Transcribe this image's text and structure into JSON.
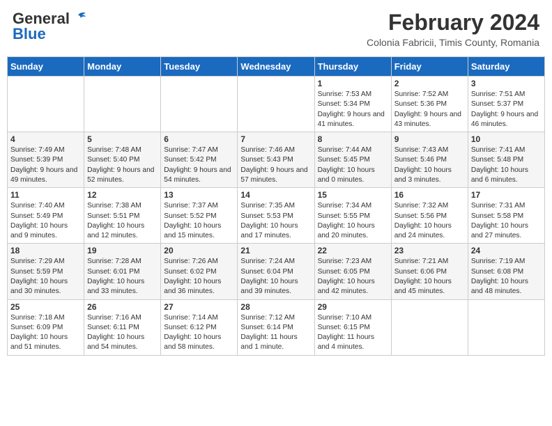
{
  "header": {
    "logo_general": "General",
    "logo_blue": "Blue",
    "month_title": "February 2024",
    "subtitle": "Colonia Fabricii, Timis County, Romania"
  },
  "days_of_week": [
    "Sunday",
    "Monday",
    "Tuesday",
    "Wednesday",
    "Thursday",
    "Friday",
    "Saturday"
  ],
  "weeks": [
    [
      {
        "day": "",
        "info": ""
      },
      {
        "day": "",
        "info": ""
      },
      {
        "day": "",
        "info": ""
      },
      {
        "day": "",
        "info": ""
      },
      {
        "day": "1",
        "info": "Sunrise: 7:53 AM\nSunset: 5:34 PM\nDaylight: 9 hours and 41 minutes."
      },
      {
        "day": "2",
        "info": "Sunrise: 7:52 AM\nSunset: 5:36 PM\nDaylight: 9 hours and 43 minutes."
      },
      {
        "day": "3",
        "info": "Sunrise: 7:51 AM\nSunset: 5:37 PM\nDaylight: 9 hours and 46 minutes."
      }
    ],
    [
      {
        "day": "4",
        "info": "Sunrise: 7:49 AM\nSunset: 5:39 PM\nDaylight: 9 hours and 49 minutes."
      },
      {
        "day": "5",
        "info": "Sunrise: 7:48 AM\nSunset: 5:40 PM\nDaylight: 9 hours and 52 minutes."
      },
      {
        "day": "6",
        "info": "Sunrise: 7:47 AM\nSunset: 5:42 PM\nDaylight: 9 hours and 54 minutes."
      },
      {
        "day": "7",
        "info": "Sunrise: 7:46 AM\nSunset: 5:43 PM\nDaylight: 9 hours and 57 minutes."
      },
      {
        "day": "8",
        "info": "Sunrise: 7:44 AM\nSunset: 5:45 PM\nDaylight: 10 hours and 0 minutes."
      },
      {
        "day": "9",
        "info": "Sunrise: 7:43 AM\nSunset: 5:46 PM\nDaylight: 10 hours and 3 minutes."
      },
      {
        "day": "10",
        "info": "Sunrise: 7:41 AM\nSunset: 5:48 PM\nDaylight: 10 hours and 6 minutes."
      }
    ],
    [
      {
        "day": "11",
        "info": "Sunrise: 7:40 AM\nSunset: 5:49 PM\nDaylight: 10 hours and 9 minutes."
      },
      {
        "day": "12",
        "info": "Sunrise: 7:38 AM\nSunset: 5:51 PM\nDaylight: 10 hours and 12 minutes."
      },
      {
        "day": "13",
        "info": "Sunrise: 7:37 AM\nSunset: 5:52 PM\nDaylight: 10 hours and 15 minutes."
      },
      {
        "day": "14",
        "info": "Sunrise: 7:35 AM\nSunset: 5:53 PM\nDaylight: 10 hours and 17 minutes."
      },
      {
        "day": "15",
        "info": "Sunrise: 7:34 AM\nSunset: 5:55 PM\nDaylight: 10 hours and 20 minutes."
      },
      {
        "day": "16",
        "info": "Sunrise: 7:32 AM\nSunset: 5:56 PM\nDaylight: 10 hours and 24 minutes."
      },
      {
        "day": "17",
        "info": "Sunrise: 7:31 AM\nSunset: 5:58 PM\nDaylight: 10 hours and 27 minutes."
      }
    ],
    [
      {
        "day": "18",
        "info": "Sunrise: 7:29 AM\nSunset: 5:59 PM\nDaylight: 10 hours and 30 minutes."
      },
      {
        "day": "19",
        "info": "Sunrise: 7:28 AM\nSunset: 6:01 PM\nDaylight: 10 hours and 33 minutes."
      },
      {
        "day": "20",
        "info": "Sunrise: 7:26 AM\nSunset: 6:02 PM\nDaylight: 10 hours and 36 minutes."
      },
      {
        "day": "21",
        "info": "Sunrise: 7:24 AM\nSunset: 6:04 PM\nDaylight: 10 hours and 39 minutes."
      },
      {
        "day": "22",
        "info": "Sunrise: 7:23 AM\nSunset: 6:05 PM\nDaylight: 10 hours and 42 minutes."
      },
      {
        "day": "23",
        "info": "Sunrise: 7:21 AM\nSunset: 6:06 PM\nDaylight: 10 hours and 45 minutes."
      },
      {
        "day": "24",
        "info": "Sunrise: 7:19 AM\nSunset: 6:08 PM\nDaylight: 10 hours and 48 minutes."
      }
    ],
    [
      {
        "day": "25",
        "info": "Sunrise: 7:18 AM\nSunset: 6:09 PM\nDaylight: 10 hours and 51 minutes."
      },
      {
        "day": "26",
        "info": "Sunrise: 7:16 AM\nSunset: 6:11 PM\nDaylight: 10 hours and 54 minutes."
      },
      {
        "day": "27",
        "info": "Sunrise: 7:14 AM\nSunset: 6:12 PM\nDaylight: 10 hours and 58 minutes."
      },
      {
        "day": "28",
        "info": "Sunrise: 7:12 AM\nSunset: 6:14 PM\nDaylight: 11 hours and 1 minute."
      },
      {
        "day": "29",
        "info": "Sunrise: 7:10 AM\nSunset: 6:15 PM\nDaylight: 11 hours and 4 minutes."
      },
      {
        "day": "",
        "info": ""
      },
      {
        "day": "",
        "info": ""
      }
    ]
  ]
}
